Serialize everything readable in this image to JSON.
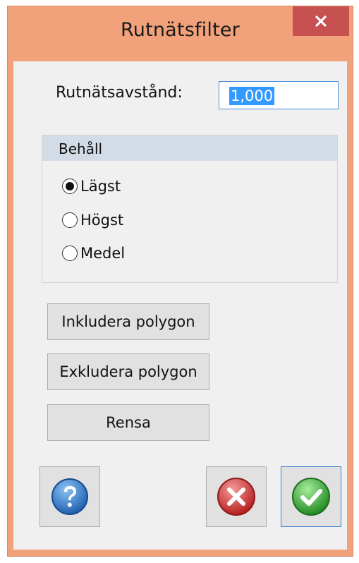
{
  "window": {
    "title": "Rutnätsfilter"
  },
  "spacing": {
    "label": "Rutnätsavstånd:",
    "value": "1,000"
  },
  "keep": {
    "header": "Behåll",
    "options": [
      {
        "label": "Lägst",
        "selected": true
      },
      {
        "label": "Högst",
        "selected": false
      },
      {
        "label": "Medel",
        "selected": false
      }
    ]
  },
  "buttons": {
    "include_polygon": "Inkludera polygon",
    "exclude_polygon": "Exkludera polygon",
    "clear": "Rensa"
  },
  "icons": {
    "close": "close-icon",
    "help": "help-icon",
    "cancel": "cancel-icon",
    "ok": "ok-icon"
  },
  "colors": {
    "frame": "#f2a27a",
    "close_button": "#c75050",
    "group_header": "#d3dbe6",
    "help_blue": "#2f7fd2",
    "cancel_red": "#d93a3a",
    "ok_green": "#3bb53b"
  }
}
